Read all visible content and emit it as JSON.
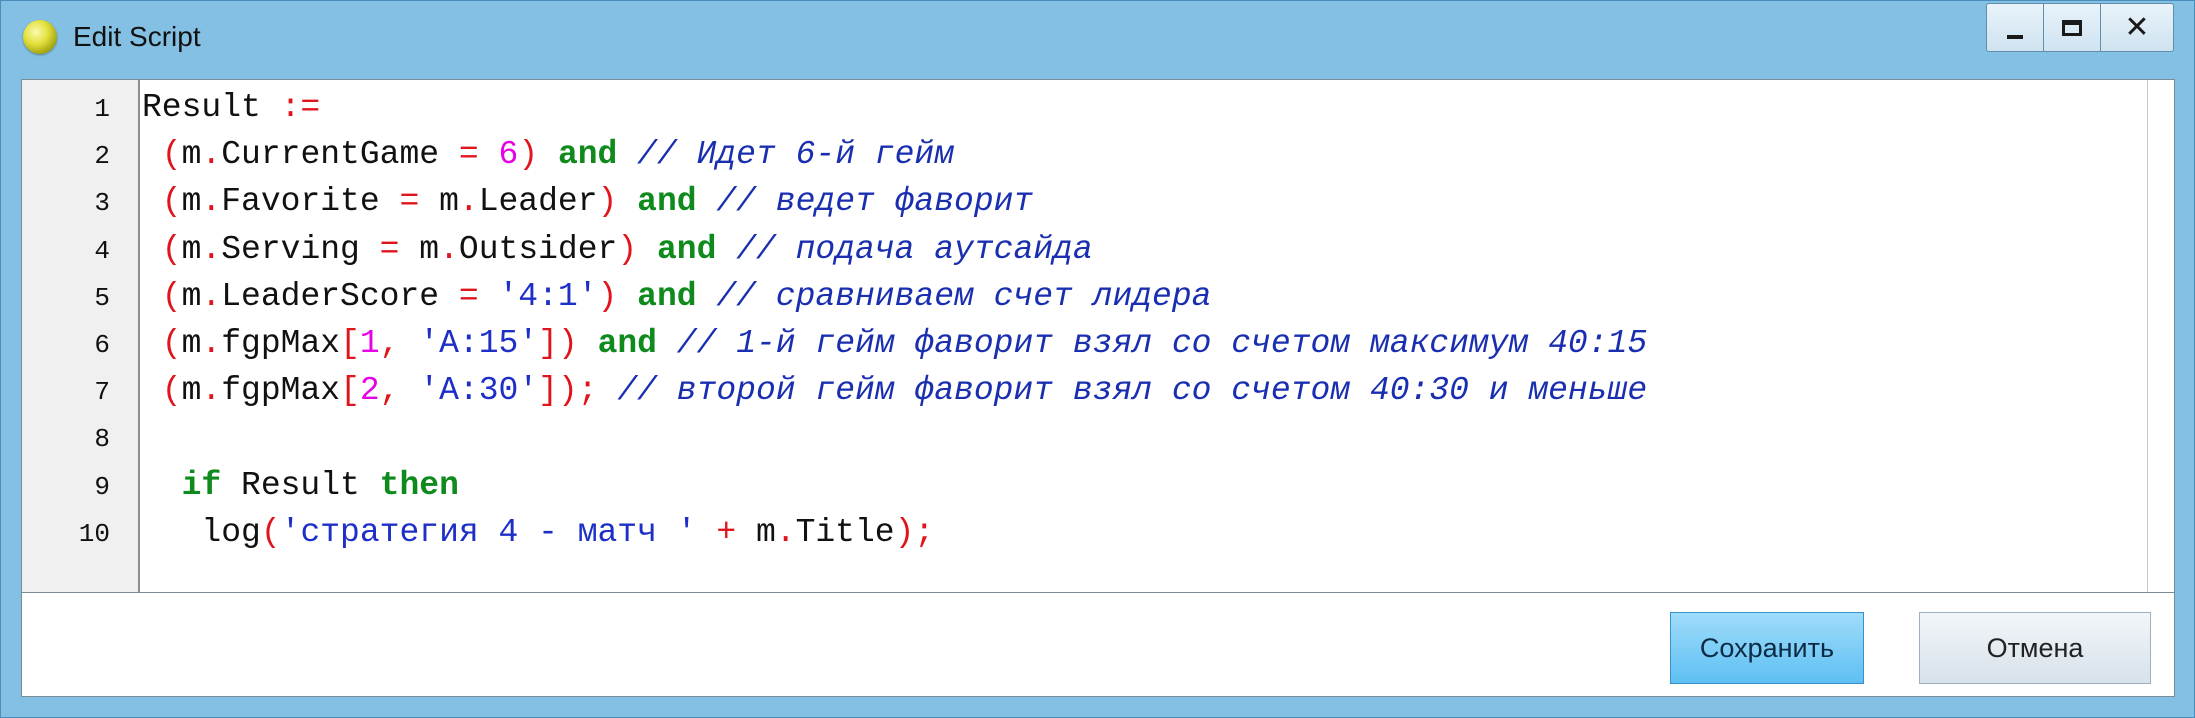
{
  "window": {
    "title": "Edit Script",
    "controls": {
      "minimize_icon": "minimize-icon",
      "maximize_icon": "maximize-icon",
      "close_icon": "close-icon",
      "close_glyph": "✕"
    }
  },
  "editor": {
    "line_numbers": [
      "1",
      "2",
      "3",
      "4",
      "5",
      "6",
      "7",
      "8",
      "9",
      "10"
    ],
    "lines": [
      [
        {
          "t": "Result ",
          "c": "plain"
        },
        {
          "t": ":=",
          "c": "sym"
        }
      ],
      [
        {
          "t": " (",
          "c": "sym"
        },
        {
          "t": "m",
          "c": "plain"
        },
        {
          "t": ".",
          "c": "sym"
        },
        {
          "t": "CurrentGame ",
          "c": "plain"
        },
        {
          "t": "=",
          "c": "sym"
        },
        {
          "t": " ",
          "c": "plain"
        },
        {
          "t": "6",
          "c": "num"
        },
        {
          "t": ")",
          "c": "sym"
        },
        {
          "t": " ",
          "c": "plain"
        },
        {
          "t": "and",
          "c": "kw"
        },
        {
          "t": " // Идет 6-й гейм",
          "c": "cm"
        }
      ],
      [
        {
          "t": " (",
          "c": "sym"
        },
        {
          "t": "m",
          "c": "plain"
        },
        {
          "t": ".",
          "c": "sym"
        },
        {
          "t": "Favorite ",
          "c": "plain"
        },
        {
          "t": "=",
          "c": "sym"
        },
        {
          "t": " m",
          "c": "plain"
        },
        {
          "t": ".",
          "c": "sym"
        },
        {
          "t": "Leader",
          "c": "plain"
        },
        {
          "t": ")",
          "c": "sym"
        },
        {
          "t": " ",
          "c": "plain"
        },
        {
          "t": "and",
          "c": "kw"
        },
        {
          "t": " // ведет фаворит",
          "c": "cm"
        }
      ],
      [
        {
          "t": " (",
          "c": "sym"
        },
        {
          "t": "m",
          "c": "plain"
        },
        {
          "t": ".",
          "c": "sym"
        },
        {
          "t": "Serving ",
          "c": "plain"
        },
        {
          "t": "=",
          "c": "sym"
        },
        {
          "t": " m",
          "c": "plain"
        },
        {
          "t": ".",
          "c": "sym"
        },
        {
          "t": "Outsider",
          "c": "plain"
        },
        {
          "t": ")",
          "c": "sym"
        },
        {
          "t": " ",
          "c": "plain"
        },
        {
          "t": "and",
          "c": "kw"
        },
        {
          "t": " // подача аутсайда",
          "c": "cm"
        }
      ],
      [
        {
          "t": " (",
          "c": "sym"
        },
        {
          "t": "m",
          "c": "plain"
        },
        {
          "t": ".",
          "c": "sym"
        },
        {
          "t": "LeaderScore ",
          "c": "plain"
        },
        {
          "t": "=",
          "c": "sym"
        },
        {
          "t": " ",
          "c": "plain"
        },
        {
          "t": "'4:1'",
          "c": "str"
        },
        {
          "t": ")",
          "c": "sym"
        },
        {
          "t": " ",
          "c": "plain"
        },
        {
          "t": "and",
          "c": "kw"
        },
        {
          "t": " // сравниваем счет лидера",
          "c": "cm"
        }
      ],
      [
        {
          "t": " (",
          "c": "sym"
        },
        {
          "t": "m",
          "c": "plain"
        },
        {
          "t": ".",
          "c": "sym"
        },
        {
          "t": "fgpMax",
          "c": "plain"
        },
        {
          "t": "[",
          "c": "sym"
        },
        {
          "t": "1",
          "c": "num"
        },
        {
          "t": ",",
          "c": "sym"
        },
        {
          "t": " ",
          "c": "plain"
        },
        {
          "t": "'A:15'",
          "c": "str"
        },
        {
          "t": "])",
          "c": "sym"
        },
        {
          "t": " ",
          "c": "plain"
        },
        {
          "t": "and",
          "c": "kw"
        },
        {
          "t": " // 1-й гейм фаворит взял со счетом максимум 40:15",
          "c": "cm"
        }
      ],
      [
        {
          "t": " (",
          "c": "sym"
        },
        {
          "t": "m",
          "c": "plain"
        },
        {
          "t": ".",
          "c": "sym"
        },
        {
          "t": "fgpMax",
          "c": "plain"
        },
        {
          "t": "[",
          "c": "sym"
        },
        {
          "t": "2",
          "c": "num"
        },
        {
          "t": ",",
          "c": "sym"
        },
        {
          "t": " ",
          "c": "plain"
        },
        {
          "t": "'A:30'",
          "c": "str"
        },
        {
          "t": "]);",
          "c": "sym"
        },
        {
          "t": " // второй гейм фаворит взял со счетом 40:30 и меньше",
          "c": "cm"
        }
      ],
      [],
      [
        {
          "t": "  ",
          "c": "plain"
        },
        {
          "t": "if",
          "c": "kw"
        },
        {
          "t": " Result ",
          "c": "plain"
        },
        {
          "t": "then",
          "c": "kw"
        }
      ],
      [
        {
          "t": "   log",
          "c": "plain"
        },
        {
          "t": "(",
          "c": "sym"
        },
        {
          "t": "'стратегия 4 - матч '",
          "c": "str"
        },
        {
          "t": " ",
          "c": "plain"
        },
        {
          "t": "+",
          "c": "sym"
        },
        {
          "t": " m",
          "c": "plain"
        },
        {
          "t": ".",
          "c": "sym"
        },
        {
          "t": "Title",
          "c": "plain"
        },
        {
          "t": ");",
          "c": "sym"
        }
      ]
    ]
  },
  "buttons": {
    "save_label": "Сохранить",
    "cancel_label": "Отмена"
  },
  "colors": {
    "symbol": "#e0141b",
    "number": "#e700e7",
    "string": "#1d2fc6",
    "keyword": "#0f8a1d",
    "comment": "#1a2fb0",
    "frame": "#83c0e4"
  }
}
